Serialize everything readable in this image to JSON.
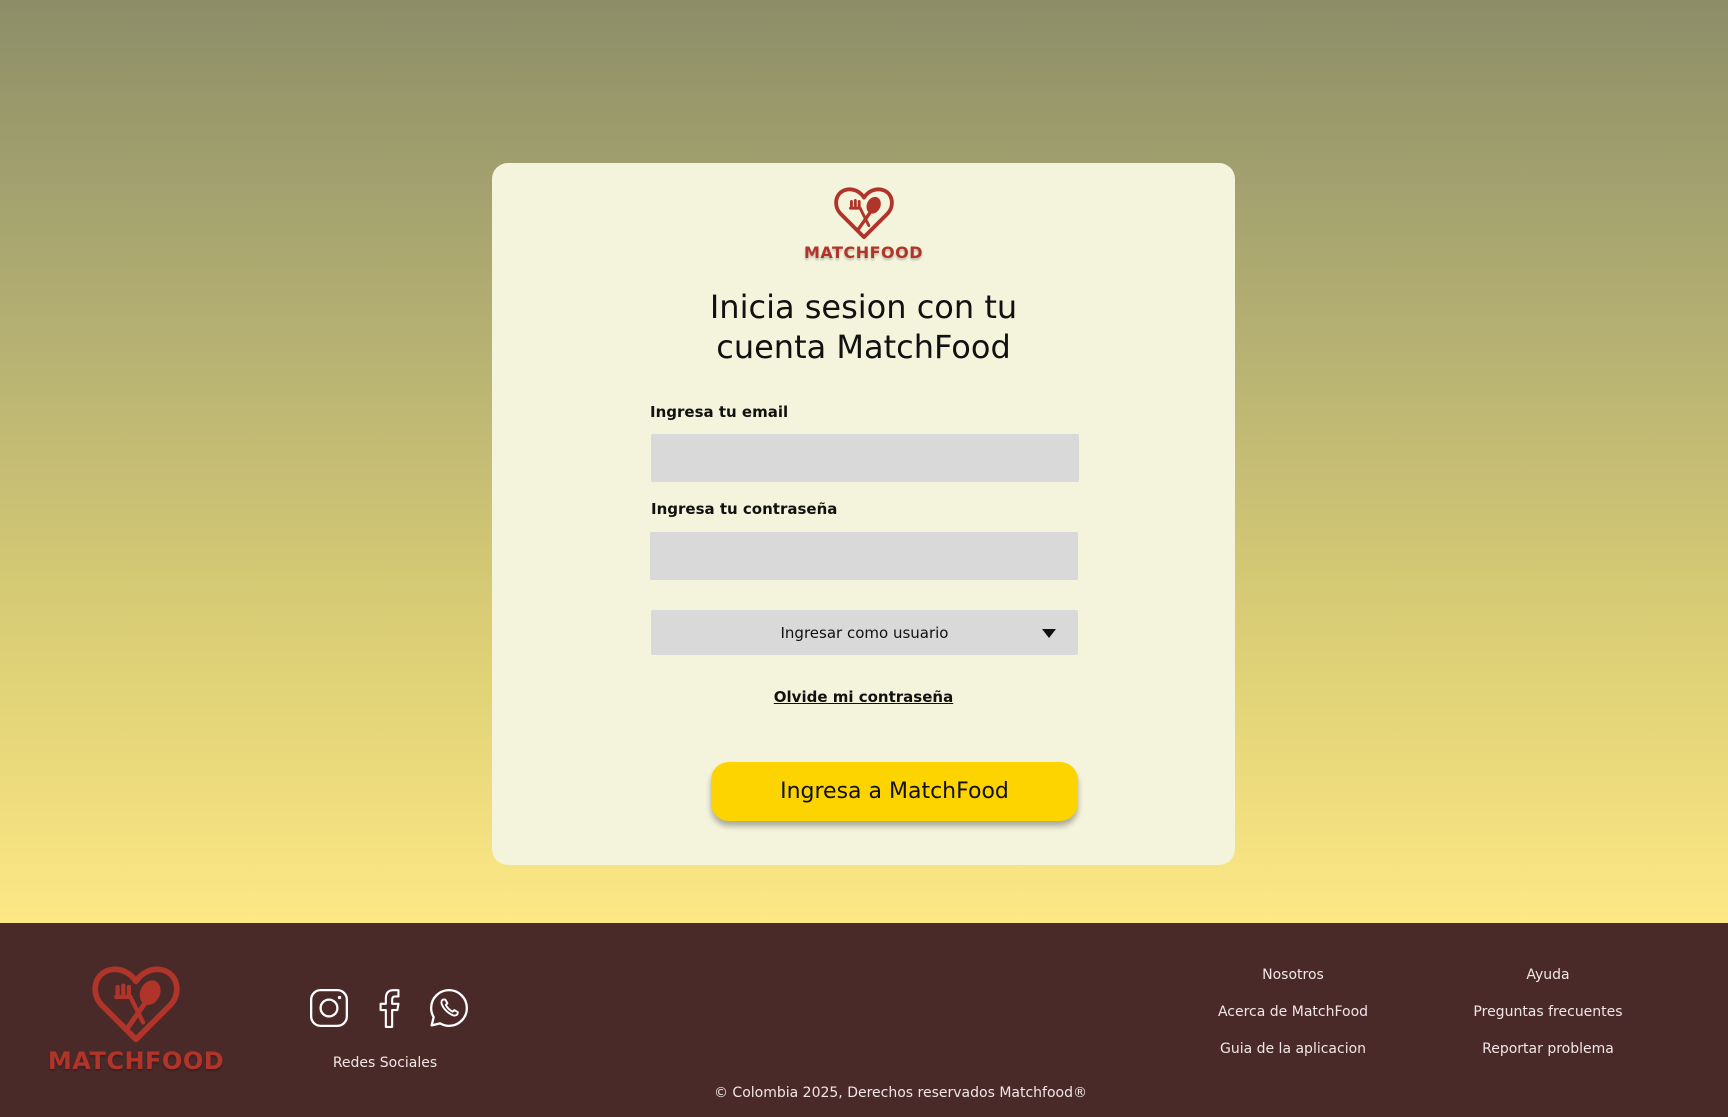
{
  "colors": {
    "brand_red": "#b1342a",
    "submit_yellow": "#fdd300",
    "footer_bg": "#4a2a29",
    "card_bg": "#f4f4dc",
    "input_bg": "#d9d9d9"
  },
  "brand": {
    "name": "MATCHFOOD",
    "logo_icon": "heart-fork-spoon-icon"
  },
  "login": {
    "title": "Inicia sesion con tu cuenta MatchFood",
    "email_label": "Ingresa tu email",
    "email_value": "",
    "password_label": "Ingresa tu contraseña",
    "password_value": "",
    "role_select": {
      "selected": "Ingresar como usuario"
    },
    "forgot_password": "Olvide mi contraseña",
    "submit_label": "Ingresa a MatchFood"
  },
  "footer": {
    "social": {
      "icons": [
        "instagram-icon",
        "facebook-icon",
        "whatsapp-icon"
      ],
      "label": "Redes Sociales"
    },
    "columns": [
      {
        "heading": "Nosotros",
        "links": [
          "Acerca de MatchFood",
          "Guia de la aplicacion"
        ]
      },
      {
        "heading": "Ayuda",
        "links": [
          "Preguntas frecuentes",
          "Reportar problema"
        ]
      }
    ],
    "copyright": "© Colombia 2025, Derechos reservados Matchfood®"
  }
}
